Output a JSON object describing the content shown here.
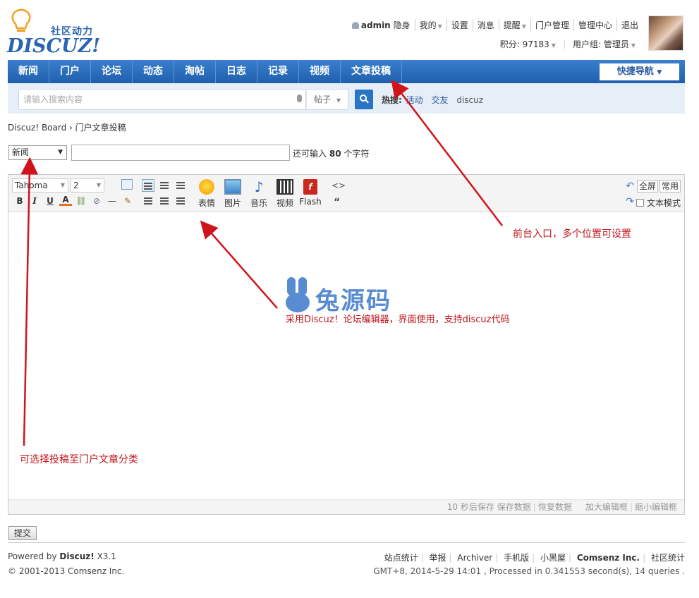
{
  "logo": {
    "subtitle": "社区动力",
    "name": "DISCUZ!"
  },
  "topbar": {
    "username": "admin",
    "items": [
      "隐身",
      "我的",
      "设置",
      "消息",
      "提醒",
      "门户管理",
      "管理中心",
      "退出"
    ],
    "credits": "积分: 97183",
    "usergroup": "用户组: 管理员"
  },
  "nav": {
    "items": [
      "新闻",
      "门户",
      "论坛",
      "动态",
      "淘帖",
      "日志",
      "记录",
      "视频",
      "文章投稿"
    ],
    "quick": "快捷导航"
  },
  "search": {
    "placeholder": "请输入搜索内容",
    "type": "帖子",
    "hot_label": "热搜:",
    "hot": [
      "活动",
      "交友",
      "discuz"
    ]
  },
  "breadcrumb": "Discuz! Board › 门户文章投稿",
  "form": {
    "category": "新闻",
    "remaining_prefix": "还可输入",
    "remaining_count": "80",
    "remaining_suffix": "个字符"
  },
  "editor": {
    "font": "Tahoma",
    "size": "2",
    "buttons": [
      "表情",
      "图片",
      "音乐",
      "视频",
      "Flash"
    ],
    "fullscreen": "全屏",
    "common": "常用",
    "textmode": "文本模式",
    "footer": [
      "10 秒后保存",
      "保存数据",
      "恢复数据",
      "加大编辑框",
      "缩小编辑框"
    ]
  },
  "submit": "提交",
  "footer": {
    "powered_prefix": "Powered by",
    "powered_brand": "Discuz!",
    "powered_version": "X3.1",
    "copyright": "© 2001-2013 Comsenz Inc.",
    "links": [
      "站点统计",
      "举报",
      "Archiver",
      "手机版",
      "小黑屋",
      "Comsenz Inc.",
      "社区统计"
    ],
    "info": "GMT+8, 2014-5-29 14:01 , Processed in 0.341553 second(s), 14 queries ."
  },
  "annotations": {
    "entry": "前台入口，多个位置可设置",
    "editor": "采用Discuz！论坛编辑器，界面使用，支持discuz代码",
    "category": "可选择投稿至门户文章分类"
  },
  "watermark": "兔源码",
  "colors": {
    "nav": "#1f5fae",
    "annotation": "#c0161d",
    "link": "#2a5aa0"
  }
}
